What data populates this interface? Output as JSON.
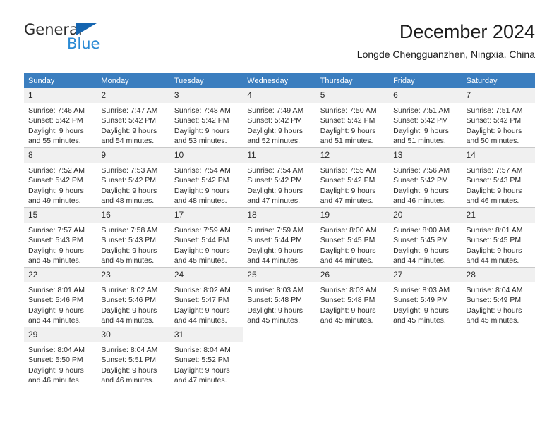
{
  "brand": {
    "name_top": "General",
    "name_bottom": "Blue",
    "accent_color": "#2a8ad4",
    "triangle_color": "#1565b0"
  },
  "header": {
    "title": "December 2024",
    "subtitle": "Longde Chengguanzhen, Ningxia, China"
  },
  "calendar": {
    "header_bg": "#3b7ebf",
    "daynum_bg": "#f0f0f0",
    "weekdays": [
      "Sunday",
      "Monday",
      "Tuesday",
      "Wednesday",
      "Thursday",
      "Friday",
      "Saturday"
    ],
    "weeks": [
      [
        {
          "day": "1",
          "sunrise": "Sunrise: 7:46 AM",
          "sunset": "Sunset: 5:42 PM",
          "daylight_1": "Daylight: 9 hours",
          "daylight_2": "and 55 minutes."
        },
        {
          "day": "2",
          "sunrise": "Sunrise: 7:47 AM",
          "sunset": "Sunset: 5:42 PM",
          "daylight_1": "Daylight: 9 hours",
          "daylight_2": "and 54 minutes."
        },
        {
          "day": "3",
          "sunrise": "Sunrise: 7:48 AM",
          "sunset": "Sunset: 5:42 PM",
          "daylight_1": "Daylight: 9 hours",
          "daylight_2": "and 53 minutes."
        },
        {
          "day": "4",
          "sunrise": "Sunrise: 7:49 AM",
          "sunset": "Sunset: 5:42 PM",
          "daylight_1": "Daylight: 9 hours",
          "daylight_2": "and 52 minutes."
        },
        {
          "day": "5",
          "sunrise": "Sunrise: 7:50 AM",
          "sunset": "Sunset: 5:42 PM",
          "daylight_1": "Daylight: 9 hours",
          "daylight_2": "and 51 minutes."
        },
        {
          "day": "6",
          "sunrise": "Sunrise: 7:51 AM",
          "sunset": "Sunset: 5:42 PM",
          "daylight_1": "Daylight: 9 hours",
          "daylight_2": "and 51 minutes."
        },
        {
          "day": "7",
          "sunrise": "Sunrise: 7:51 AM",
          "sunset": "Sunset: 5:42 PM",
          "daylight_1": "Daylight: 9 hours",
          "daylight_2": "and 50 minutes."
        }
      ],
      [
        {
          "day": "8",
          "sunrise": "Sunrise: 7:52 AM",
          "sunset": "Sunset: 5:42 PM",
          "daylight_1": "Daylight: 9 hours",
          "daylight_2": "and 49 minutes."
        },
        {
          "day": "9",
          "sunrise": "Sunrise: 7:53 AM",
          "sunset": "Sunset: 5:42 PM",
          "daylight_1": "Daylight: 9 hours",
          "daylight_2": "and 48 minutes."
        },
        {
          "day": "10",
          "sunrise": "Sunrise: 7:54 AM",
          "sunset": "Sunset: 5:42 PM",
          "daylight_1": "Daylight: 9 hours",
          "daylight_2": "and 48 minutes."
        },
        {
          "day": "11",
          "sunrise": "Sunrise: 7:54 AM",
          "sunset": "Sunset: 5:42 PM",
          "daylight_1": "Daylight: 9 hours",
          "daylight_2": "and 47 minutes."
        },
        {
          "day": "12",
          "sunrise": "Sunrise: 7:55 AM",
          "sunset": "Sunset: 5:42 PM",
          "daylight_1": "Daylight: 9 hours",
          "daylight_2": "and 47 minutes."
        },
        {
          "day": "13",
          "sunrise": "Sunrise: 7:56 AM",
          "sunset": "Sunset: 5:42 PM",
          "daylight_1": "Daylight: 9 hours",
          "daylight_2": "and 46 minutes."
        },
        {
          "day": "14",
          "sunrise": "Sunrise: 7:57 AM",
          "sunset": "Sunset: 5:43 PM",
          "daylight_1": "Daylight: 9 hours",
          "daylight_2": "and 46 minutes."
        }
      ],
      [
        {
          "day": "15",
          "sunrise": "Sunrise: 7:57 AM",
          "sunset": "Sunset: 5:43 PM",
          "daylight_1": "Daylight: 9 hours",
          "daylight_2": "and 45 minutes."
        },
        {
          "day": "16",
          "sunrise": "Sunrise: 7:58 AM",
          "sunset": "Sunset: 5:43 PM",
          "daylight_1": "Daylight: 9 hours",
          "daylight_2": "and 45 minutes."
        },
        {
          "day": "17",
          "sunrise": "Sunrise: 7:59 AM",
          "sunset": "Sunset: 5:44 PM",
          "daylight_1": "Daylight: 9 hours",
          "daylight_2": "and 45 minutes."
        },
        {
          "day": "18",
          "sunrise": "Sunrise: 7:59 AM",
          "sunset": "Sunset: 5:44 PM",
          "daylight_1": "Daylight: 9 hours",
          "daylight_2": "and 44 minutes."
        },
        {
          "day": "19",
          "sunrise": "Sunrise: 8:00 AM",
          "sunset": "Sunset: 5:45 PM",
          "daylight_1": "Daylight: 9 hours",
          "daylight_2": "and 44 minutes."
        },
        {
          "day": "20",
          "sunrise": "Sunrise: 8:00 AM",
          "sunset": "Sunset: 5:45 PM",
          "daylight_1": "Daylight: 9 hours",
          "daylight_2": "and 44 minutes."
        },
        {
          "day": "21",
          "sunrise": "Sunrise: 8:01 AM",
          "sunset": "Sunset: 5:45 PM",
          "daylight_1": "Daylight: 9 hours",
          "daylight_2": "and 44 minutes."
        }
      ],
      [
        {
          "day": "22",
          "sunrise": "Sunrise: 8:01 AM",
          "sunset": "Sunset: 5:46 PM",
          "daylight_1": "Daylight: 9 hours",
          "daylight_2": "and 44 minutes."
        },
        {
          "day": "23",
          "sunrise": "Sunrise: 8:02 AM",
          "sunset": "Sunset: 5:46 PM",
          "daylight_1": "Daylight: 9 hours",
          "daylight_2": "and 44 minutes."
        },
        {
          "day": "24",
          "sunrise": "Sunrise: 8:02 AM",
          "sunset": "Sunset: 5:47 PM",
          "daylight_1": "Daylight: 9 hours",
          "daylight_2": "and 44 minutes."
        },
        {
          "day": "25",
          "sunrise": "Sunrise: 8:03 AM",
          "sunset": "Sunset: 5:48 PM",
          "daylight_1": "Daylight: 9 hours",
          "daylight_2": "and 45 minutes."
        },
        {
          "day": "26",
          "sunrise": "Sunrise: 8:03 AM",
          "sunset": "Sunset: 5:48 PM",
          "daylight_1": "Daylight: 9 hours",
          "daylight_2": "and 45 minutes."
        },
        {
          "day": "27",
          "sunrise": "Sunrise: 8:03 AM",
          "sunset": "Sunset: 5:49 PM",
          "daylight_1": "Daylight: 9 hours",
          "daylight_2": "and 45 minutes."
        },
        {
          "day": "28",
          "sunrise": "Sunrise: 8:04 AM",
          "sunset": "Sunset: 5:49 PM",
          "daylight_1": "Daylight: 9 hours",
          "daylight_2": "and 45 minutes."
        }
      ],
      [
        {
          "day": "29",
          "sunrise": "Sunrise: 8:04 AM",
          "sunset": "Sunset: 5:50 PM",
          "daylight_1": "Daylight: 9 hours",
          "daylight_2": "and 46 minutes."
        },
        {
          "day": "30",
          "sunrise": "Sunrise: 8:04 AM",
          "sunset": "Sunset: 5:51 PM",
          "daylight_1": "Daylight: 9 hours",
          "daylight_2": "and 46 minutes."
        },
        {
          "day": "31",
          "sunrise": "Sunrise: 8:04 AM",
          "sunset": "Sunset: 5:52 PM",
          "daylight_1": "Daylight: 9 hours",
          "daylight_2": "and 47 minutes."
        },
        {
          "day": "",
          "sunrise": "",
          "sunset": "",
          "daylight_1": "",
          "daylight_2": ""
        },
        {
          "day": "",
          "sunrise": "",
          "sunset": "",
          "daylight_1": "",
          "daylight_2": ""
        },
        {
          "day": "",
          "sunrise": "",
          "sunset": "",
          "daylight_1": "",
          "daylight_2": ""
        },
        {
          "day": "",
          "sunrise": "",
          "sunset": "",
          "daylight_1": "",
          "daylight_2": ""
        }
      ]
    ]
  }
}
